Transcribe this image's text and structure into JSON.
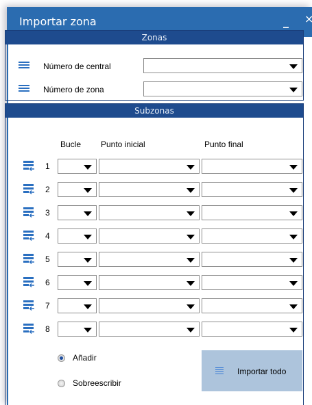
{
  "window": {
    "title": "Importar zona",
    "minimize": "_",
    "close": "×"
  },
  "zonas": {
    "header": "Zonas",
    "central_label": "Número de central",
    "central_value": "",
    "zona_label": "Número de zona",
    "zona_value": ""
  },
  "subzonas": {
    "header": "Subzonas",
    "columns": {
      "bucle": "Bucle",
      "inicial": "Punto inicial",
      "final": "Punto final"
    },
    "rows": [
      {
        "num": "1"
      },
      {
        "num": "2"
      },
      {
        "num": "3"
      },
      {
        "num": "4"
      },
      {
        "num": "5"
      },
      {
        "num": "6"
      },
      {
        "num": "7"
      },
      {
        "num": "8"
      }
    ]
  },
  "options": {
    "anadir": "Añadir",
    "sobreescribir": "Sobreescribir",
    "selected": "anadir"
  },
  "import_all_label": "Importar todo",
  "colors": {
    "titlebar": "#2b6cb0",
    "section_header": "#1e4b8e",
    "accent": "#2a6fc0",
    "button": "#adc4dc"
  }
}
